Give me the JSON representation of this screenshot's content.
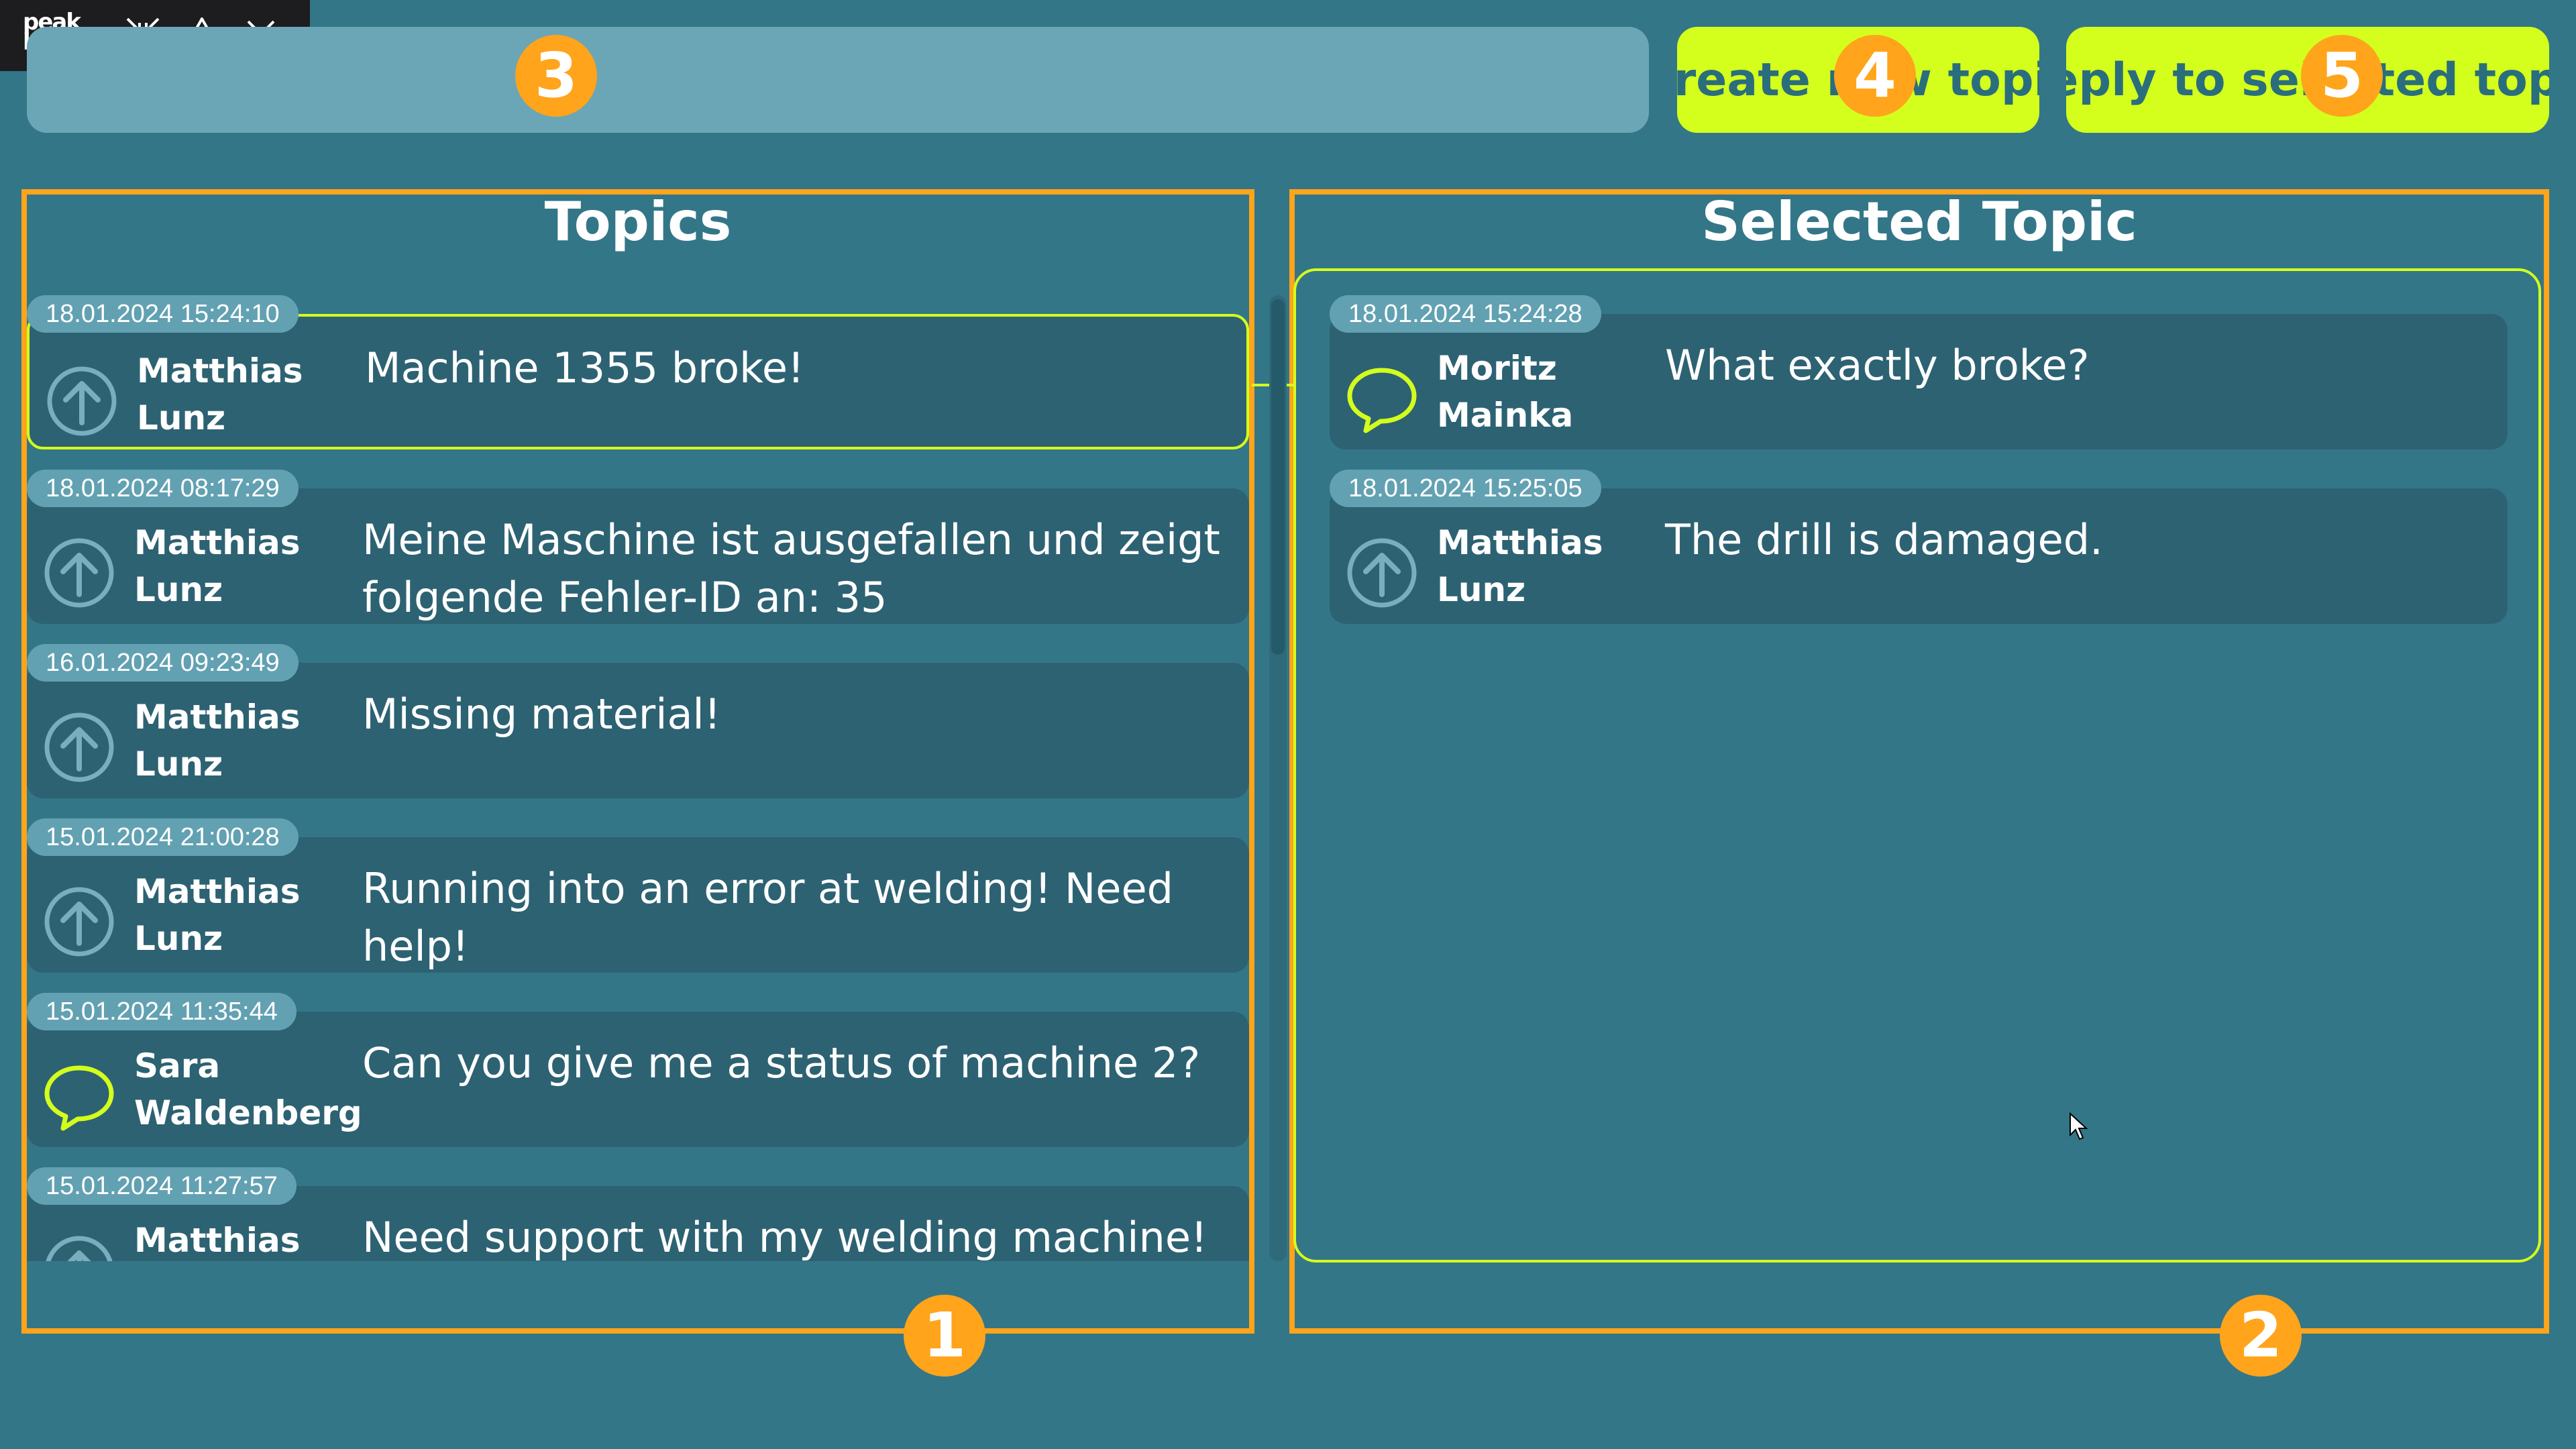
{
  "app": {
    "logo_text": "peak board",
    "toolbar_icons": [
      "collapse-arrows-icon",
      "warning-icon",
      "close-icon"
    ]
  },
  "search": {
    "value": "",
    "placeholder": ""
  },
  "actions": {
    "create_label": "Create new topic",
    "reply_label": "Reply to selected topic"
  },
  "markers": {
    "topics_list": "1",
    "selected_topic": "2",
    "search": "3",
    "create_button": "4",
    "reply_button": "5"
  },
  "topics_panel": {
    "title": "Topics",
    "items": [
      {
        "timestamp": "18.01.2024 15:24:10",
        "author": "Matthias Lunz",
        "icon": "arrow-up-circle-icon",
        "text": "Machine 1355 broke!",
        "selected": true
      },
      {
        "timestamp": "18.01.2024 08:17:29",
        "author": "Matthias Lunz",
        "icon": "arrow-up-circle-icon",
        "text": "Meine Maschine ist ausgefallen und zeigt folgende Fehler-ID an: 35",
        "selected": false
      },
      {
        "timestamp": "16.01.2024 09:23:49",
        "author": "Matthias Lunz",
        "icon": "arrow-up-circle-icon",
        "text": "Missing material!",
        "selected": false
      },
      {
        "timestamp": "15.01.2024 21:00:28",
        "author": "Matthias Lunz",
        "icon": "arrow-up-circle-icon",
        "text": "Running into an error at welding! Need help!",
        "selected": false
      },
      {
        "timestamp": "15.01.2024 11:35:44",
        "author": "Sara Waldenberg",
        "icon": "speech-bubble-icon",
        "text": "Can you give me a status of machine 2?",
        "selected": false
      },
      {
        "timestamp": "15.01.2024 11:27:57",
        "author": "Matthias Lunz",
        "icon": "arrow-up-circle-icon",
        "text": "Need support with my welding machine! Can",
        "selected": false
      }
    ]
  },
  "selected_panel": {
    "title": "Selected Topic",
    "messages": [
      {
        "timestamp": "18.01.2024 15:24:28",
        "author": "Moritz Mainka",
        "icon": "speech-bubble-icon",
        "text": "What exactly broke?"
      },
      {
        "timestamp": "18.01.2024 15:25:05",
        "author": "Matthias Lunz",
        "icon": "arrow-up-circle-icon",
        "text": "The drill is damaged."
      }
    ]
  },
  "colors": {
    "background": "#337688",
    "card": "#2d6273",
    "accent": "#d4ff1c",
    "annotation": "#ffa41b",
    "pill": "#62a1b2"
  }
}
